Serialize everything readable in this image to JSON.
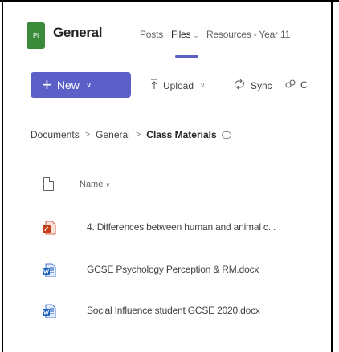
{
  "team": {
    "avatar_initials": "PI",
    "name": "General"
  },
  "tabs": [
    {
      "label": "Posts"
    },
    {
      "label": "Files",
      "chevron": "⌄"
    },
    {
      "label": "Resources - Year 11"
    }
  ],
  "toolbar": {
    "new_label": "New",
    "upload_label": "Upload",
    "sync_label": "Sync",
    "more_label": "C"
  },
  "breadcrumb": {
    "items": [
      "Documents",
      "General",
      "Class Materials"
    ]
  },
  "list": {
    "name_header": "Name"
  },
  "files": [
    {
      "name": "4. Differences between human and animal c...",
      "type": "pdf"
    },
    {
      "name": "GCSE Psychology Perception & RM.docx",
      "type": "docx"
    },
    {
      "name": "Social Influence student GCSE 2020.docx",
      "type": "docx"
    }
  ],
  "colors": {
    "accent": "#5b5fc7",
    "avatar_bg": "#3a8a3a",
    "pdf_red": "#c43e1c",
    "word_blue": "#185abd"
  },
  "icons": {
    "upload": "upload-icon",
    "sync": "sync-icon",
    "more": "copy-link-icon",
    "document_header": "document-icon",
    "pdf": "pdf-file-icon",
    "word": "word-file-icon"
  }
}
